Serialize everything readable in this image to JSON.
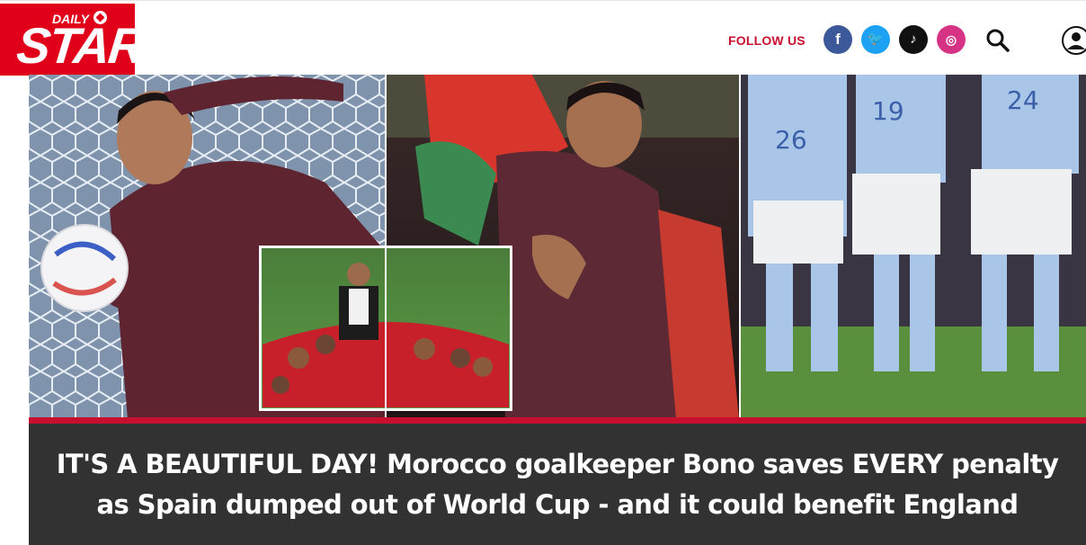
{
  "brand": {
    "daily": "DAILY",
    "star": "STAR"
  },
  "header": {
    "follow_label": "FOLLOW US",
    "social": [
      {
        "name": "facebook",
        "glyph": "f",
        "color": "#3b5998"
      },
      {
        "name": "twitter",
        "glyph": "🐦",
        "color": "#1da1f2"
      },
      {
        "name": "tiktok",
        "glyph": "♪",
        "color": "#111111"
      },
      {
        "name": "instagram",
        "glyph": "◎",
        "color": "#d63384"
      }
    ],
    "search_icon": "search-icon",
    "account_icon": "user-icon"
  },
  "hero": {
    "panels": [
      "goalkeeper-dive-photo",
      "celebration-hug-photo",
      "spain-players-photo"
    ],
    "inset": "coach-celebration-photo",
    "jersey_numbers": [
      "26",
      "19",
      "24"
    ]
  },
  "article": {
    "headline": "IT'S A BEAUTIFUL DAY! Morocco goalkeeper Bono saves EVERY penalty as Spain dumped out of World Cup - and it could benefit England"
  },
  "colors": {
    "brand_red": "#e0001a",
    "accent_red": "#c8102e",
    "headline_bg": "#333232"
  }
}
